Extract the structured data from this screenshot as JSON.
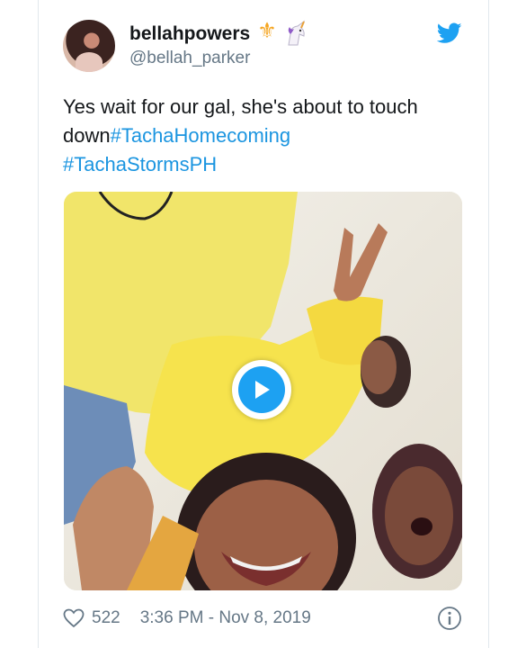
{
  "tweet": {
    "display_name": "bellahpowers",
    "badges": [
      "trident-emoji",
      "unicorn-emoji"
    ],
    "handle": "@bellah_parker",
    "text_before": "Yes wait for our gal, she's about to touch down",
    "hashtags": [
      "#TachaHomecoming",
      "#TachaStormsPH"
    ],
    "media": {
      "type": "video",
      "icon": "play-icon"
    },
    "likes": "522",
    "timestamp": "3:36 PM - Nov 8, 2019"
  },
  "colors": {
    "link": "#1b95e0",
    "twitter_blue": "#1da1f2",
    "secondary_text": "#657786",
    "border": "#e1e8ed"
  }
}
